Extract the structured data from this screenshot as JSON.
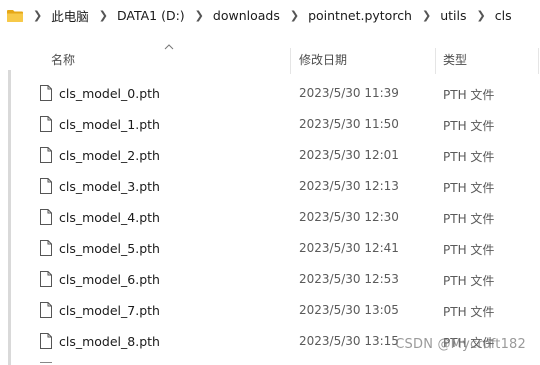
{
  "breadcrumb": {
    "items": [
      "此电脑",
      "DATA1 (D:)",
      "downloads",
      "pointnet.pytorch",
      "utils",
      "cls"
    ]
  },
  "columns": {
    "name": "名称",
    "date": "修改日期",
    "type": "类型"
  },
  "files": [
    {
      "name": "cls_model_0.pth",
      "date": "2023/5/30 11:39",
      "type": "PTH 文件"
    },
    {
      "name": "cls_model_1.pth",
      "date": "2023/5/30 11:50",
      "type": "PTH 文件"
    },
    {
      "name": "cls_model_2.pth",
      "date": "2023/5/30 12:01",
      "type": "PTH 文件"
    },
    {
      "name": "cls_model_3.pth",
      "date": "2023/5/30 12:13",
      "type": "PTH 文件"
    },
    {
      "name": "cls_model_4.pth",
      "date": "2023/5/30 12:30",
      "type": "PTH 文件"
    },
    {
      "name": "cls_model_5.pth",
      "date": "2023/5/30 12:41",
      "type": "PTH 文件"
    },
    {
      "name": "cls_model_6.pth",
      "date": "2023/5/30 12:53",
      "type": "PTH 文件"
    },
    {
      "name": "cls_model_7.pth",
      "date": "2023/5/30 13:05",
      "type": "PTH 文件"
    },
    {
      "name": "cls_model_8.pth",
      "date": "2023/5/30 13:15",
      "type": "PTH 文件"
    }
  ],
  "watermark": "CSDN @Mycroft182",
  "colors": {
    "folder": "#f7c948",
    "folder_dark": "#e6a817"
  }
}
